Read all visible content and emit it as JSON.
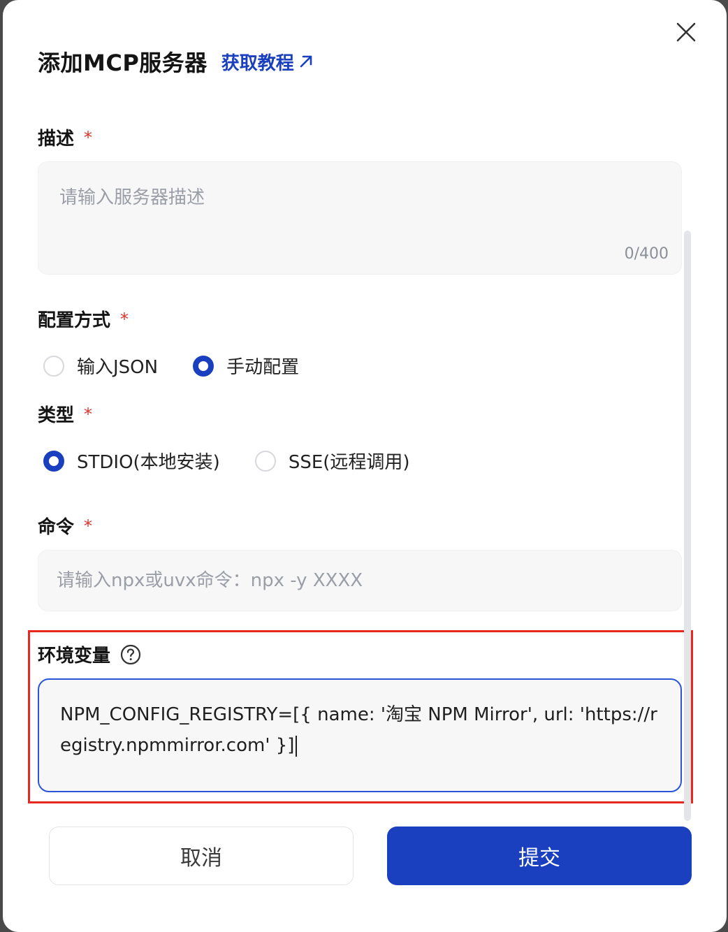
{
  "modal": {
    "title": "添加MCP服务器",
    "tutorial_link": "获取教程"
  },
  "description": {
    "label": "描述",
    "required_mark": "*",
    "placeholder": "请输入服务器描述",
    "value": "",
    "counter": "0/400"
  },
  "config_method": {
    "label": "配置方式",
    "required_mark": "*",
    "options": [
      {
        "label": "输入JSON",
        "checked": false
      },
      {
        "label": "手动配置",
        "checked": true
      }
    ]
  },
  "type": {
    "label": "类型",
    "required_mark": "*",
    "options": [
      {
        "label": "STDIO(本地安装)",
        "checked": true
      },
      {
        "label": "SSE(远程调用)",
        "checked": false
      }
    ]
  },
  "command": {
    "label": "命令",
    "required_mark": "*",
    "placeholder": "请输入npx或uvx命令：npx -y XXXX",
    "value": ""
  },
  "env": {
    "label": "环境变量",
    "value": "NPM_CONFIG_REGISTRY=[{ name: '淘宝 NPM Mirror', url: 'https://registry.npmmirror.com' }]"
  },
  "footer": {
    "cancel_label": "取消",
    "submit_label": "提交"
  },
  "colors": {
    "accent": "#1a3fbf",
    "required": "#e0302a",
    "highlight_box": "#e8271f"
  },
  "icons": {
    "close": "close-icon",
    "external": "external-link-icon",
    "help": "help-circle-icon"
  }
}
